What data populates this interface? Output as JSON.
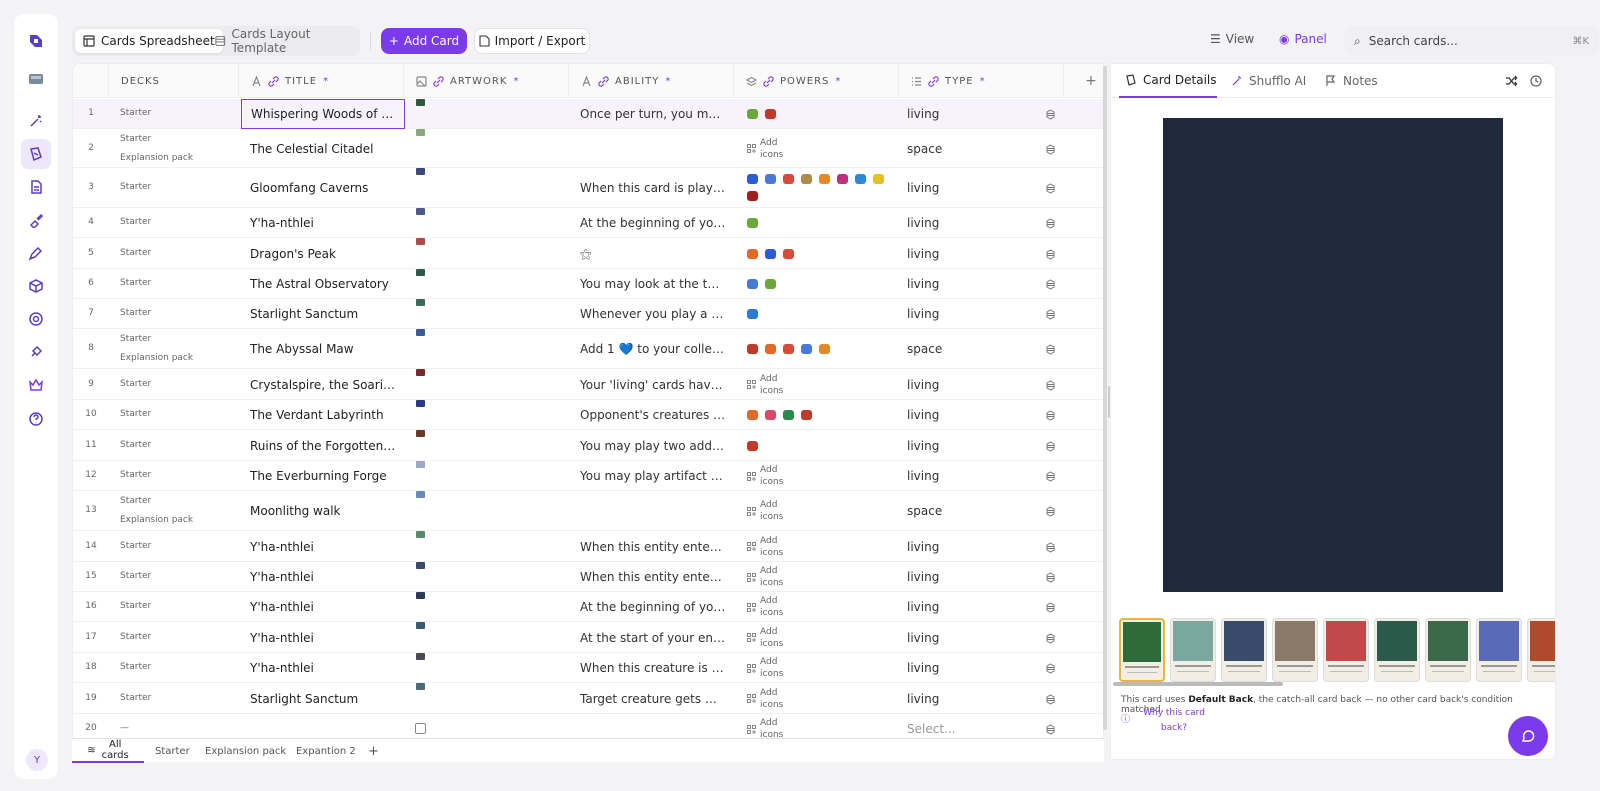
{
  "toolbar": {
    "tab_spreadsheet": "Cards Spreadsheet",
    "tab_layout": "Cards Layout Template",
    "add_card": "Add Card",
    "import_export": "Import / Export",
    "view": "View",
    "panel": "Panel",
    "search_placeholder": "Search cards...",
    "search_kbd": "⌘K"
  },
  "columns": {
    "decks": "DECKS",
    "title": "TITLE",
    "artwork": "ARTWORK",
    "ability": "ABILITY",
    "powers": "POWERS",
    "type": "TYPE",
    "required_mark": "*"
  },
  "add_icons_label": [
    "Add",
    "icons"
  ],
  "rows": [
    {
      "n": "1",
      "decks": [
        "Starter"
      ],
      "title": "Whispering Woods of Whi...",
      "art": "#2e5a3a",
      "ability": "Once per turn, you may lo...",
      "powers": [
        "#6aa83a",
        "#c0392b"
      ],
      "type": "living"
    },
    {
      "n": "2",
      "decks": [
        "Starter",
        "Explansion pack"
      ],
      "title": "The Celestial Citadel",
      "art": "#8aa87a",
      "ability": "",
      "powers": [],
      "type": "space"
    },
    {
      "n": "3",
      "decks": [
        "Starter"
      ],
      "title": "Gloomfang Caverns",
      "art": "#3a4a7a",
      "ability": "When this card is played, t...",
      "powers": [
        "#2c5bd8",
        "#4a7ad8",
        "#d84a3a",
        "#b08a4a",
        "#e88a20",
        "#c03080",
        "#2a8ad8",
        "#e8c020",
        "#a02020"
      ],
      "type": "living"
    },
    {
      "n": "4",
      "decks": [
        "Starter"
      ],
      "title": "Y'ha-nthlei",
      "art": "#4a5a8a",
      "ability": "At the beginning of your t...",
      "powers": [
        "#6aa83a"
      ],
      "type": "living"
    },
    {
      "n": "5",
      "decks": [
        "Starter"
      ],
      "title": "Dragon's Peak",
      "art": "#b04a4a",
      "ability": "⚝",
      "powers": [
        "#e06a2a",
        "#2c5bd8",
        "#d84a3a"
      ],
      "type": "living"
    },
    {
      "n": "6",
      "decks": [
        "Starter"
      ],
      "title": "The Astral Observatory",
      "art": "#2a5a4a",
      "ability": "You may look at the top ca...",
      "powers": [
        "#4a7ad8",
        "#6aa83a"
      ],
      "type": "living"
    },
    {
      "n": "7",
      "decks": [
        "Starter"
      ],
      "title": "Starlight Sanctum",
      "art": "#3a6a5a",
      "ability": "Whenever you play a 'spac...",
      "powers": [
        "#2a7ad8"
      ],
      "type": "living"
    },
    {
      "n": "8",
      "decks": [
        "Starter",
        "Explansion pack"
      ],
      "title": "The Abyssal Maw",
      "art": "#3a5a9a",
      "ability": "Add 1 💙 to your collection...",
      "powers": [
        "#c0392b",
        "#e06a2a",
        "#d84a3a",
        "#4a7ad8",
        "#e08a2a"
      ],
      "type": "space"
    },
    {
      "n": "9",
      "decks": [
        "Starter"
      ],
      "title": "Crystalspire, the Soaring C...",
      "art": "#7a2a2a",
      "ability": "Your 'living' cards have +1/...",
      "powers": [],
      "type": "living"
    },
    {
      "n": "10",
      "decks": [
        "Starter"
      ],
      "title": "The Verdant Labyrinth",
      "art": "#2a3a8a",
      "ability": "Opponent's creatures atta...",
      "powers": [
        "#e06a2a",
        "#d84a6a",
        "#2a8a4a",
        "#c0392b"
      ],
      "type": "living"
    },
    {
      "n": "11",
      "decks": [
        "Starter"
      ],
      "title": "Ruins of the Forgotten Kin...",
      "art": "#6a3a2a",
      "ability": "You may play two addition...",
      "powers": [
        "#c0392b"
      ],
      "type": "living"
    },
    {
      "n": "12",
      "decks": [
        "Starter"
      ],
      "title": "The Everburning Forge",
      "art": "#9aaac8",
      "ability": "You may play artifact card...",
      "powers": [],
      "type": "living"
    },
    {
      "n": "13",
      "decks": [
        "Starter",
        "Explansion pack"
      ],
      "title": "Moonlithg walk",
      "art": "#6a8ab8",
      "ability": "",
      "powers": [],
      "type": "space"
    },
    {
      "n": "14",
      "decks": [
        "Starter"
      ],
      "title": "Y'ha-nthlei",
      "art": "#5a8a6a",
      "ability": "When this entity enters th...",
      "powers": [],
      "type": "living"
    },
    {
      "n": "15",
      "decks": [
        "Starter"
      ],
      "title": "Y'ha-nthlei",
      "art": "#3a4a6a",
      "ability": "When this entity enters th...",
      "powers": [],
      "type": "living"
    },
    {
      "n": "16",
      "decks": [
        "Starter"
      ],
      "title": "Y'ha-nthlei",
      "art": "#2a3a5a",
      "ability": "At the beginning of your t...",
      "powers": [],
      "type": "living"
    },
    {
      "n": "17",
      "decks": [
        "Starter"
      ],
      "title": "Y'ha-nthlei",
      "art": "#3a5a7a",
      "ability": "At the start of your end st...",
      "powers": [],
      "type": "living"
    },
    {
      "n": "18",
      "decks": [
        "Starter"
      ],
      "title": "Y'ha-nthlei",
      "art": "#4a4a5a",
      "ability": "When this creature is dealt...",
      "powers": [],
      "type": "living"
    },
    {
      "n": "19",
      "decks": [
        "Starter"
      ],
      "title": "Starlight Sanctum",
      "art": "#4a6a7a",
      "ability": "Target creature gets +2/+...",
      "powers": [],
      "type": "living"
    },
    {
      "n": "20",
      "decks": [
        "—"
      ],
      "title": "",
      "art": "",
      "ability": "",
      "powers": [],
      "type": "Select..."
    }
  ],
  "footer_tabs": {
    "all_1": "All",
    "all_2": "cards",
    "starter": "Starter",
    "expansion": "Explansion pack",
    "expansion2": "Expantion 2",
    "add": "+"
  },
  "panel": {
    "tab_details": "Card Details",
    "tab_ai": "Shufflo AI",
    "tab_notes": "Notes",
    "explain_pre": "This card uses ",
    "explain_bold": "Default Back",
    "explain_post": ", the catch-all card back — no other card back's condition matched.",
    "why": "Why this card back?"
  },
  "thumb_colors": [
    "#2e6a3a",
    "#7aa8a0",
    "#3a4a6a",
    "#8a7a6a",
    "#c04a4a",
    "#2a5a4a",
    "#3a6a4a",
    "#5a6ab8",
    "#b04a2a"
  ],
  "avatar": "Y"
}
